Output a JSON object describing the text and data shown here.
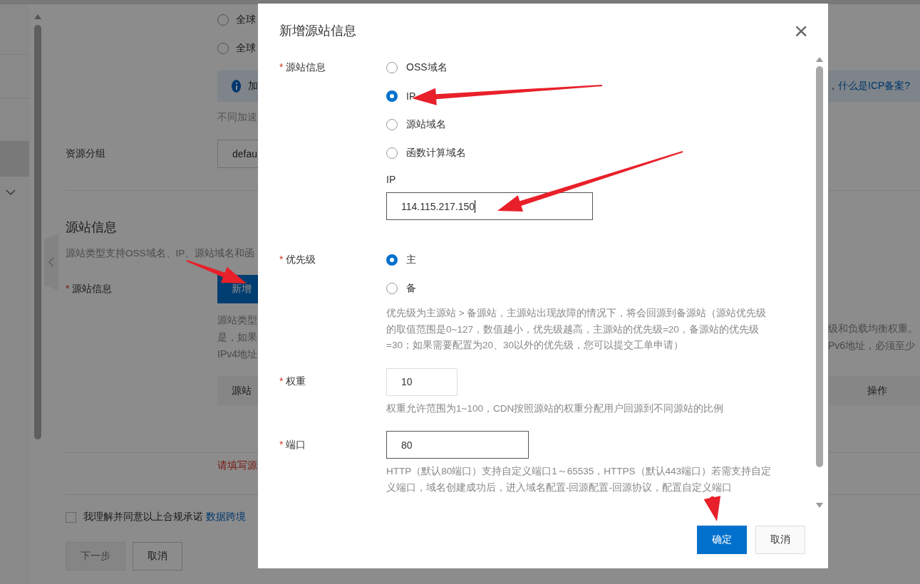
{
  "background_page": {
    "region_options": [
      {
        "label": "全球",
        "selected": false
      },
      {
        "label": "全球",
        "selected": false
      }
    ],
    "notice": {
      "text": "加",
      "text_right": "，",
      "link": "什么是ICP备案?"
    },
    "note": "不同加速",
    "resource_group": {
      "label": "资源分组",
      "value": "defau"
    },
    "origin_section": {
      "title": "源站信息",
      "description": "源站类型支持OSS域名、IP、源站域名和函",
      "field_label": "源站信息",
      "required_mark": "*",
      "add_button": "新增",
      "help_left": [
        "源站类型",
        "是，如果",
        "IPv4地址"
      ],
      "help_right": [
        "级和负载均衡权重。",
        "Pv6地址，必须至少"
      ],
      "table_columns": [
        "源站",
        "操作"
      ],
      "error": "请填写源"
    },
    "agreement": {
      "checked": false,
      "text": "我理解并同意以上合规承诺",
      "link": "数据跨境"
    },
    "buttons": [
      {
        "label": "下一步",
        "disabled": true
      },
      {
        "label": "取消",
        "disabled": false
      }
    ]
  },
  "dialog": {
    "title": "新增源站信息",
    "close": "×",
    "fields": [
      {
        "kind": "radio",
        "label": "源站信息",
        "required_mark": "*",
        "options": [
          {
            "label": "OSS域名",
            "selected": false
          },
          {
            "label": "IP",
            "selected": true
          },
          {
            "label": "源站域名",
            "selected": false
          },
          {
            "label": "函数计算域名",
            "selected": false
          }
        ],
        "input": {
          "label": "IP",
          "value": "114.115.217.150",
          "focused": true
        }
      },
      {
        "kind": "radio",
        "label": "优先级",
        "required_mark": "*",
        "options": [
          {
            "label": "主",
            "selected": true
          },
          {
            "label": "备",
            "selected": false
          }
        ],
        "help": "优先级为主源站 > 备源站，主源站出现故障的情况下，将会回源到备源站（源站优先级的取值范围是0~127，数值越小，优先级越高，主源站的优先级=20，备源站的优先级=30；如果需要配置为20、30以外的优先级，您可以提交工单申请）"
      },
      {
        "kind": "number",
        "label": "权重",
        "required_mark": "*",
        "value": "10",
        "help": "权重允许范围为1~100，CDN按照源站的权重分配用户回源到不同源站的比例"
      },
      {
        "kind": "text",
        "label": "端口",
        "required_mark": "*",
        "value": "80",
        "help": "HTTP（默认80端口）支持自定义端口1～65535，HTTPS（默认443端口）若需支持自定义端口，域名创建成功后，进入域名配置-回源配置-回源协议，配置自定义端口"
      }
    ],
    "buttons": [
      {
        "label": "确定",
        "kind": "primary"
      },
      {
        "label": "取消",
        "kind": "default"
      }
    ]
  }
}
